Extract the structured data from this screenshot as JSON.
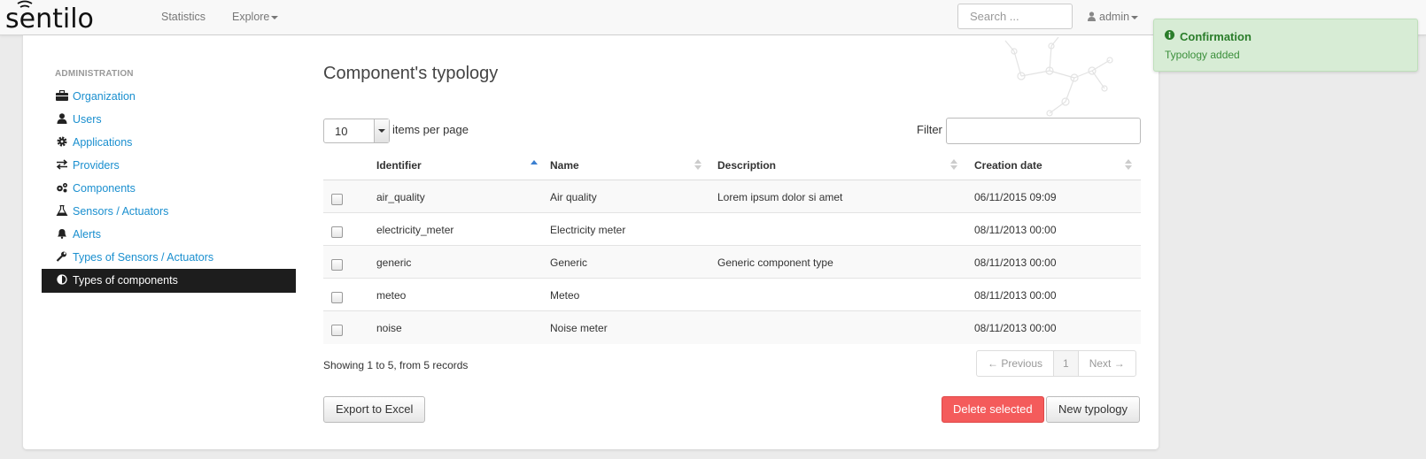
{
  "navbar": {
    "brand": "sentilo",
    "links": [
      "Statistics",
      "Explore"
    ],
    "search_placeholder": "Search ...",
    "user": "admin"
  },
  "sidebar": {
    "header": "ADMINISTRATION",
    "items": [
      {
        "label": "Organization",
        "icon": "briefcase-icon"
      },
      {
        "label": "Users",
        "icon": "user-icon"
      },
      {
        "label": "Applications",
        "icon": "gear-icon"
      },
      {
        "label": "Providers",
        "icon": "exchange-icon"
      },
      {
        "label": "Components",
        "icon": "gears-icon"
      },
      {
        "label": "Sensors / Actuators",
        "icon": "flask-icon"
      },
      {
        "label": "Alerts",
        "icon": "bell-icon"
      },
      {
        "label": "Types of Sensors / Actuators",
        "icon": "wrench-icon"
      },
      {
        "label": "Types of components",
        "icon": "adjust-icon",
        "active": true
      }
    ]
  },
  "main": {
    "title": "Component's typology",
    "per_page_value": "10",
    "per_page_label": "items per page",
    "filter_label": "Filter",
    "filter_value": "",
    "columns": [
      "Identifier",
      "Name",
      "Description",
      "Creation date"
    ],
    "rows": [
      {
        "identifier": "air_quality",
        "name": "Air quality",
        "description": "Lorem ipsum dolor si amet",
        "created": "06/11/2015 09:09"
      },
      {
        "identifier": "electricity_meter",
        "name": "Electricity meter",
        "description": "",
        "created": "08/11/2013 00:00"
      },
      {
        "identifier": "generic",
        "name": "Generic",
        "description": "Generic component type",
        "created": "08/11/2013 00:00"
      },
      {
        "identifier": "meteo",
        "name": "Meteo",
        "description": "",
        "created": "08/11/2013 00:00"
      },
      {
        "identifier": "noise",
        "name": "Noise meter",
        "description": "",
        "created": "08/11/2013 00:00"
      }
    ],
    "showing": "Showing 1 to 5, from 5 records",
    "pagination": {
      "previous": "← Previous",
      "page": "1",
      "next": "Next →"
    },
    "buttons": {
      "export": "Export to Excel",
      "delete": "Delete selected",
      "new": "New typology"
    }
  },
  "toast": {
    "title": "Confirmation",
    "message": "Typology added",
    "color": "#d7ecd5"
  },
  "colors": {
    "link": "#1a8fcf",
    "active_bg": "#1d1d1d",
    "danger": "#f45b5b"
  }
}
